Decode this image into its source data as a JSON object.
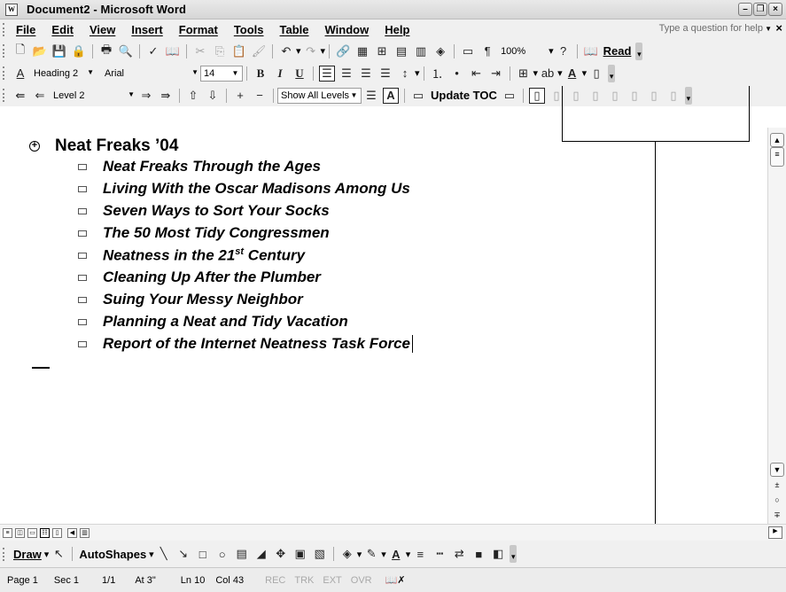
{
  "window": {
    "title": "Document2 - Microsoft Word",
    "app_icon_glyph": "W"
  },
  "menubar": {
    "items": [
      "File",
      "Edit",
      "View",
      "Insert",
      "Format",
      "Tools",
      "Table",
      "Window",
      "Help"
    ],
    "help_placeholder": "Type a question for help",
    "close_glyph": "×"
  },
  "standard_toolbar": {
    "zoom": "100%",
    "read_label": "Read"
  },
  "formatting_toolbar": {
    "style": "Heading 2",
    "font": "Arial",
    "size": "14"
  },
  "outlining_toolbar": {
    "level": "Level 2",
    "show_level": "Show All Levels",
    "update_toc": "Update TOC"
  },
  "document": {
    "heading": "Neat Freaks ’04",
    "items": [
      "Neat Freaks Through the Ages",
      "Living With the Oscar Madisons Among Us",
      "Seven Ways to Sort Your Socks",
      "The 50 Most Tidy Congressmen",
      "Neatness in the 21",
      "Cleaning Up After the Plumber",
      "Suing Your Messy Neighbor",
      "Planning a Neat and Tidy Vacation",
      "Report of the Internet Neatness Task Force"
    ],
    "item5_superscript": "st",
    "item5_suffix": " Century"
  },
  "drawing_toolbar": {
    "draw": "Draw",
    "autoshapes": "AutoShapes"
  },
  "status": {
    "page": "Page 1",
    "sec": "Sec 1",
    "pages": "1/1",
    "at": "At 3\"",
    "ln": "Ln 10",
    "col": "Col 43",
    "rec": "REC",
    "trk": "TRK",
    "ext": "EXT",
    "ovr": "OVR"
  }
}
